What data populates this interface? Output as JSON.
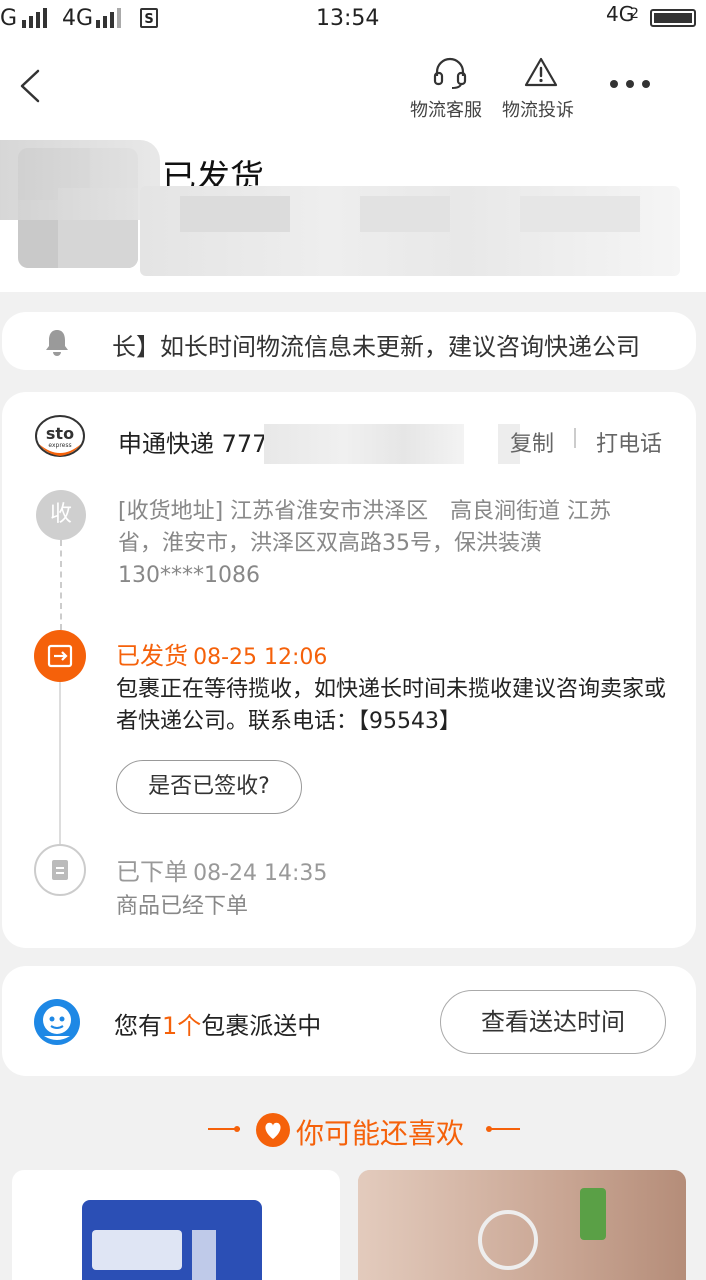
{
  "status_bar": {
    "carrier1": "G",
    "carrier2": "4G",
    "sim_label": "S",
    "time": "13:54",
    "net_right": "4G",
    "net_right_sub": "2"
  },
  "header": {
    "customer_service_label": "物流客服",
    "complaint_label": "物流投诉",
    "status_title": "已发货"
  },
  "notice": {
    "text": "长】如长时间物流信息未更新，建议咨询快递公司"
  },
  "logistics": {
    "carrier_name": "申通快递 777",
    "copy_label": "复制",
    "call_label": "打电话",
    "logo_text": "sto",
    "logo_sub": "express",
    "receive_node": "收",
    "address": "[收货地址] 江苏省淮安市洪泽区　高良涧街道 江苏省，淮安市，洪泽区双高路35号，保洪装潢 130****1086",
    "events": [
      {
        "status": "已发货",
        "time": "08-25  12:06",
        "description": "包裹正在等待揽收，如快递长时间未揽收建议咨询卖家或者快递公司。联系电话：【95543】"
      },
      {
        "status": "已下单",
        "time": "08-24  14:35",
        "description": "商品已经下单"
      }
    ],
    "signed_button": "是否已签收?"
  },
  "delivery": {
    "prefix": "您有",
    "count": "1个",
    "suffix": "包裹派送中",
    "eta_button": "查看送达时间"
  },
  "recommend": {
    "title": "你可能还喜欢"
  },
  "colors": {
    "accent": "#f5610a",
    "background": "#f1f1f1",
    "card": "#ffffff"
  }
}
